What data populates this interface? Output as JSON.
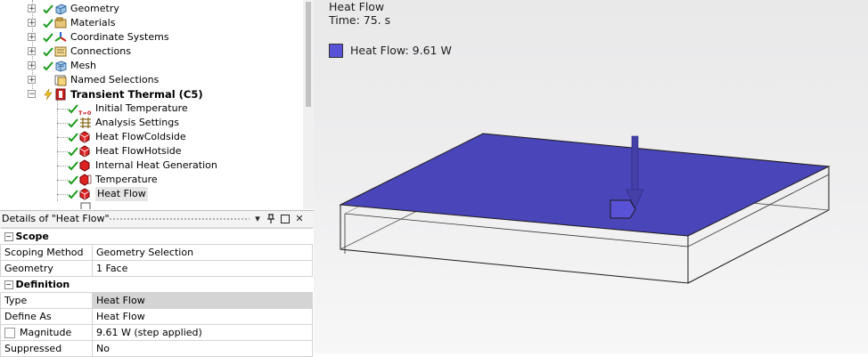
{
  "tree": {
    "items": [
      {
        "label": "Geometry",
        "icon": "geometry-icon"
      },
      {
        "label": "Materials",
        "icon": "materials-icon"
      },
      {
        "label": "Coordinate Systems",
        "icon": "coordinate-systems-icon"
      },
      {
        "label": "Connections",
        "icon": "connections-icon"
      },
      {
        "label": "Mesh",
        "icon": "mesh-icon"
      },
      {
        "label": "Named Selections",
        "icon": "named-selections-icon"
      },
      {
        "label": "Transient Thermal (C5)",
        "icon": "transient-thermal-icon"
      },
      {
        "label": "Initial Temperature",
        "icon": "initial-temperature-icon",
        "icon_text": "T=0"
      },
      {
        "label": "Analysis Settings",
        "icon": "analysis-settings-icon"
      },
      {
        "label": "Heat FlowColdside",
        "icon": "heat-flow-icon"
      },
      {
        "label": "Heat FlowHotside",
        "icon": "heat-flow-icon"
      },
      {
        "label": "Internal Heat Generation",
        "icon": "internal-heat-generation-icon"
      },
      {
        "label": "Temperature",
        "icon": "temperature-icon"
      },
      {
        "label": "Heat Flow",
        "icon": "heat-flow-icon"
      }
    ]
  },
  "details": {
    "title": "Details of \"Heat Flow\"",
    "groups": [
      {
        "name": "Scope",
        "rows": [
          {
            "key": "Scoping Method",
            "value": "Geometry Selection"
          },
          {
            "key": "Geometry",
            "value": "1 Face"
          }
        ]
      },
      {
        "name": "Definition",
        "rows": [
          {
            "key": "Type",
            "value": "Heat Flow"
          },
          {
            "key": "Define As",
            "value": "Heat Flow"
          },
          {
            "key": "Magnitude",
            "value": "9.61 W  (step applied)"
          },
          {
            "key": "Suppressed",
            "value": "No"
          }
        ]
      }
    ]
  },
  "viewport": {
    "title": "Heat Flow",
    "time": "Time: 75. s",
    "legend_label": "Heat Flow: 9.61 W"
  },
  "colors": {
    "face_fill": "#4a45b8",
    "legend_swatch": "#5a52d6",
    "arrow": "#4440a8",
    "check_green": "#1a9a1a"
  }
}
